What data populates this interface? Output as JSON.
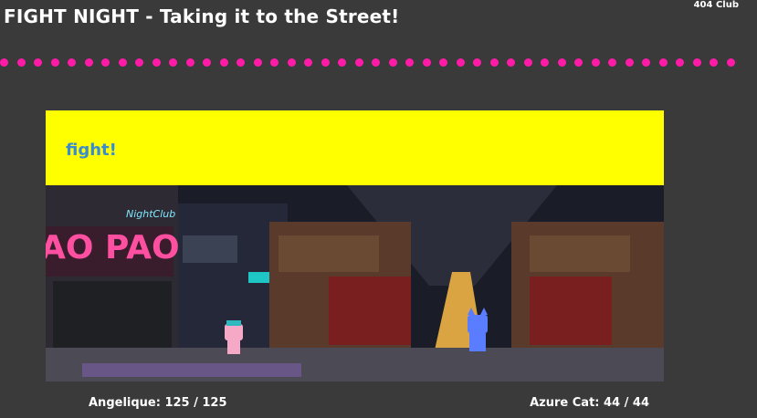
{
  "header": {
    "title": "FIGHT NIGHT - Taking it to the Street!",
    "club": "404 Club"
  },
  "colors": {
    "background": "#3a3a3a",
    "dots": "#ff1aa8",
    "banner": "#ffff00",
    "banner_text": "#3a8cd0"
  },
  "banner": {
    "text": "fight!"
  },
  "stage": {
    "signs": {
      "pao": "AO PAO",
      "nightclub": "NightClub"
    }
  },
  "fighters": {
    "player": {
      "label": "Angelique: 125 / 125"
    },
    "opponent": {
      "label": "Azure Cat: 44 / 44"
    }
  }
}
